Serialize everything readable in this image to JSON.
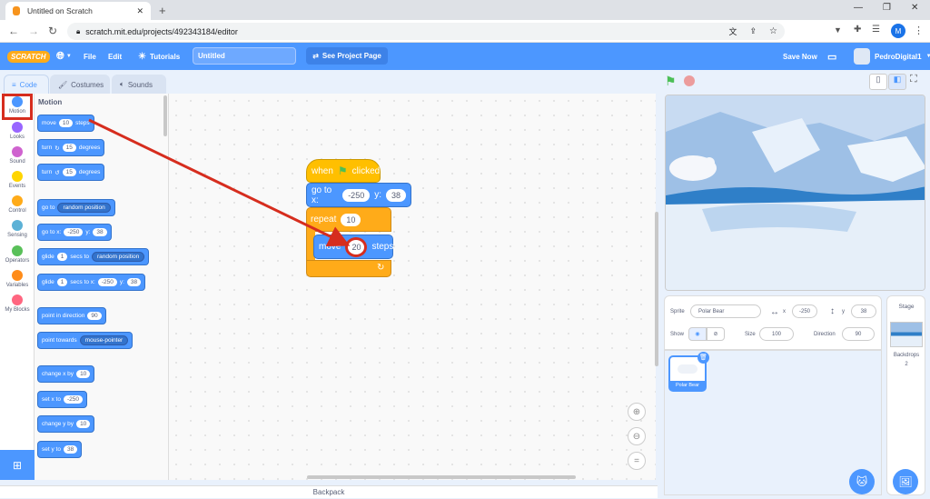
{
  "browser": {
    "tab_title": "Untitled on Scratch",
    "url": "scratch.mit.edu/projects/492343184/editor",
    "profile_initial": "M"
  },
  "menu": {
    "logo": "SCRATCH",
    "file": "File",
    "edit": "Edit",
    "tutorials": "Tutorials",
    "project_title": "Untitled",
    "see_project": "See Project Page",
    "save_now": "Save Now",
    "username": "PedroDigital1"
  },
  "editor_tabs": {
    "code": "Code",
    "costumes": "Costumes",
    "sounds": "Sounds"
  },
  "categories": [
    {
      "label": "Motion",
      "color": "#4c97ff"
    },
    {
      "label": "Looks",
      "color": "#9966ff"
    },
    {
      "label": "Sound",
      "color": "#cf63cf"
    },
    {
      "label": "Events",
      "color": "#ffd500"
    },
    {
      "label": "Control",
      "color": "#ffab19"
    },
    {
      "label": "Sensing",
      "color": "#5cb1d6"
    },
    {
      "label": "Operators",
      "color": "#59c059"
    },
    {
      "label": "Variables",
      "color": "#ff8c1a"
    },
    {
      "label": "My Blocks",
      "color": "#ff6680"
    }
  ],
  "palette": {
    "heading": "Motion",
    "move": {
      "a": "move",
      "v": "10",
      "b": "steps"
    },
    "turn_right": {
      "a": "turn",
      "v": "15",
      "b": "degrees"
    },
    "turn_left": {
      "a": "turn",
      "v": "15",
      "b": "degrees"
    },
    "goto": {
      "a": "go to",
      "dd": "random position"
    },
    "gotoxy": {
      "a": "go to x:",
      "x": "-250",
      "b": "y:",
      "y": "38"
    },
    "glide_to": {
      "a": "glide",
      "v": "1",
      "b": "secs to",
      "dd": "random position"
    },
    "glide_xy": {
      "a": "glide",
      "v": "1",
      "b": "secs to x:",
      "x": "-250",
      "c": "y:",
      "y": "38"
    },
    "point_dir": {
      "a": "point in direction",
      "v": "90"
    },
    "point_towards": {
      "a": "point towards",
      "dd": "mouse-pointer"
    },
    "change_x": {
      "a": "change x by",
      "v": "10"
    },
    "set_x": {
      "a": "set x to",
      "v": "-250"
    },
    "change_y": {
      "a": "change y by",
      "v": "10"
    },
    "set_y": {
      "a": "set y to",
      "v": "38"
    }
  },
  "script": {
    "hat_when": "when",
    "hat_clicked": "clicked",
    "goto_label": "go to x:",
    "goto_x": "-250",
    "goto_y_label": "y:",
    "goto_y": "38",
    "repeat_label": "repeat",
    "repeat_count": "10",
    "move_label": "move",
    "move_steps": "20",
    "move_steps_label": "steps"
  },
  "sprite": {
    "sprite_label": "Sprite",
    "name": "Polar Bear",
    "x_label": "x",
    "x": "-250",
    "y_label": "y",
    "y": "38",
    "show_label": "Show",
    "size_label": "Size",
    "size": "100",
    "direction_label": "Direction",
    "direction": "90",
    "thumb_label": "Polar Bear"
  },
  "stage_panel": {
    "title": "Stage",
    "backdrops_label": "Backdrops",
    "backdrops_count": "2"
  },
  "backpack": "Backpack",
  "colors": {
    "motion": "#4c97ff",
    "events": "#ffbf00",
    "control": "#ffab19",
    "menubar": "#4c97ff",
    "highlight": "#d62d1e"
  }
}
